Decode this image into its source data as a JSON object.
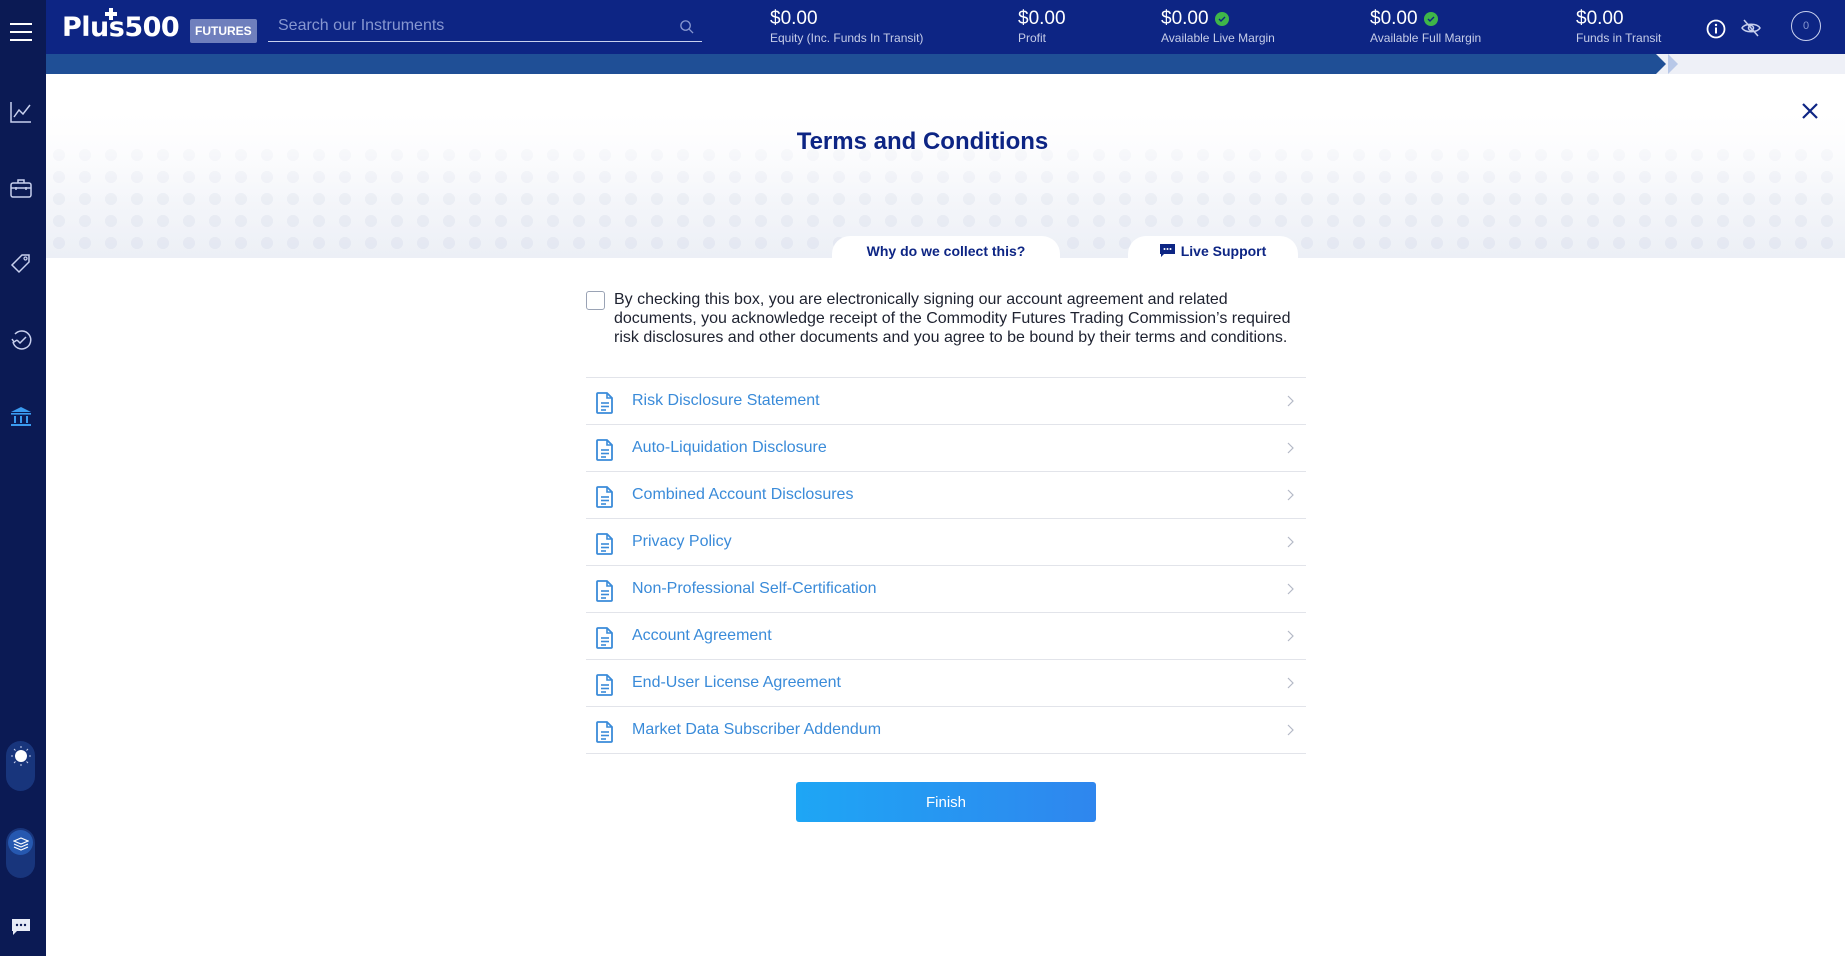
{
  "app": {
    "logo_text": "Plus500",
    "badge": "FUTURES"
  },
  "search": {
    "placeholder": "Search our Instruments",
    "value": ""
  },
  "stats": [
    {
      "value": "$0.00",
      "label": "Equity (Inc. Funds In Transit)",
      "check": false
    },
    {
      "value": "$0.00",
      "label": "Profit",
      "check": false
    },
    {
      "value": "$0.00",
      "label": "Available Live Margin",
      "check": true
    },
    {
      "value": "$0.00",
      "label": "Available Full Margin",
      "check": true
    },
    {
      "value": "$0.00",
      "label": "Funds in Transit",
      "check": false
    }
  ],
  "notifications": {
    "count": "0"
  },
  "sidebar": {
    "items": [
      {
        "name": "chart",
        "icon": "line-chart-icon"
      },
      {
        "name": "portfolio",
        "icon": "briefcase-icon"
      },
      {
        "name": "orders",
        "icon": "tag-icon"
      },
      {
        "name": "history",
        "icon": "history-check-icon"
      },
      {
        "name": "funds",
        "icon": "bank-icon",
        "active": true
      }
    ]
  },
  "modal": {
    "title": "Terms and Conditions",
    "tabs": {
      "why": "Why do we collect this?",
      "support": "Live Support"
    },
    "agreement_text": "By checking this box, you are electronically signing our account agreement and related documents, you acknowledge receipt of the Commodity Futures Trading Commission’s required risk disclosures and other documents and you agree to be bound by their terms and conditions.",
    "agreement_checked": false,
    "documents": [
      "Risk Disclosure Statement",
      "Auto-Liquidation Disclosure",
      "Combined Account Disclosures",
      "Privacy Policy",
      "Non-Professional Self-Certification",
      "Account Agreement",
      "End-User License Agreement",
      "Market Data Subscriber Addendum"
    ],
    "finish_label": "Finish"
  },
  "colors": {
    "navy": "#0d2584",
    "sidebar": "#0b1a54",
    "link": "#3a8bd9",
    "success": "#3fb649",
    "button_start": "#1ea6f5",
    "button_end": "#2f86ee"
  }
}
